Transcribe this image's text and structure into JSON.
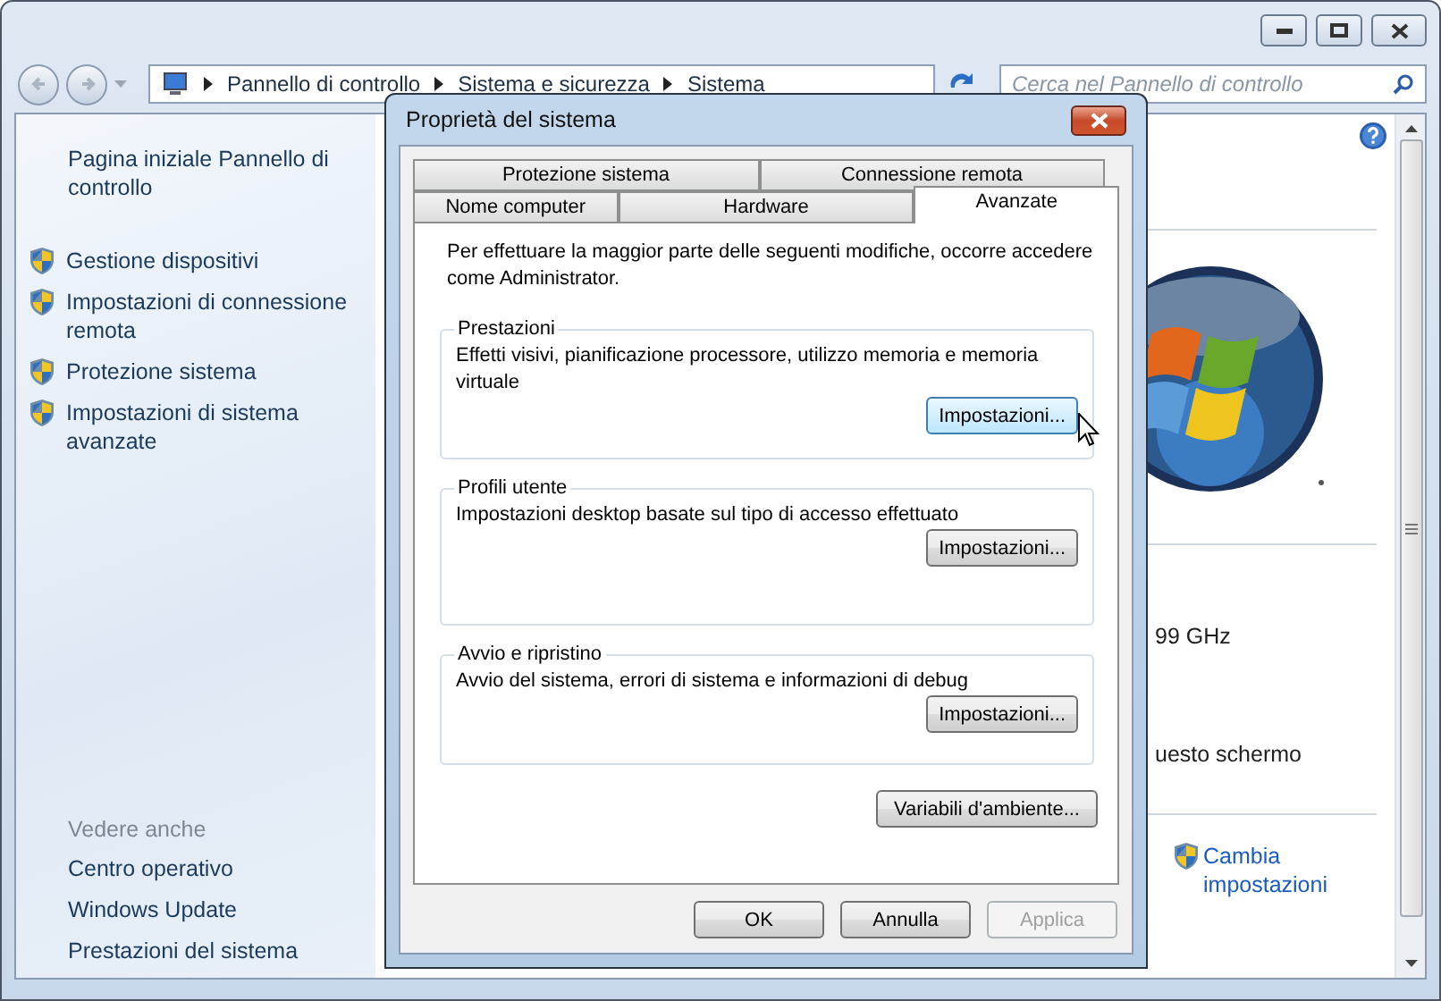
{
  "address_bar": {
    "breadcrumbs": [
      "Pannello di controllo",
      "Sistema e sicurezza",
      "Sistema"
    ]
  },
  "search": {
    "placeholder": "Cerca nel Pannello di controllo"
  },
  "sidebar": {
    "home_link": "Pagina iniziale Pannello di controllo",
    "tasks": [
      "Gestione dispositivi",
      "Impostazioni di connessione remota",
      "Protezione sistema",
      "Impostazioni di sistema avanzate"
    ],
    "see_also_title": "Vedere anche",
    "see_also": [
      "Centro operativo",
      "Windows Update",
      "Prestazioni del sistema"
    ]
  },
  "main": {
    "texts": [
      "99 GHz",
      "uesto schermo"
    ],
    "change_link": "Cambia impostazioni"
  },
  "dialog": {
    "title": "Proprietà del sistema",
    "tab_rows": [
      [
        {
          "label": "Protezione sistema",
          "selected": false
        },
        {
          "label": "Connessione remota",
          "selected": false
        }
      ],
      [
        {
          "label": "Nome computer",
          "selected": false
        },
        {
          "label": "Hardware",
          "selected": false
        },
        {
          "label": "Avanzate",
          "selected": true
        }
      ]
    ],
    "intro": "Per effettuare la maggior parte delle seguenti modifiche, occorre accedere come Administrator.",
    "groups": [
      {
        "title": "Prestazioni",
        "description": "Effetti visivi, pianificazione processore, utilizzo memoria e memoria virtuale",
        "button": "Impostazioni...",
        "hovered": true
      },
      {
        "title": "Profili utente",
        "description": "Impostazioni desktop basate sul tipo di accesso effettuato",
        "button": "Impostazioni...",
        "hovered": false
      },
      {
        "title": "Avvio e ripristino",
        "description": "Avvio del sistema, errori di sistema e informazioni di debug",
        "button": "Impostazioni...",
        "hovered": false
      }
    ],
    "env_button": "Variabili d'ambiente...",
    "buttons": [
      {
        "label": "OK",
        "disabled": false
      },
      {
        "label": "Annulla",
        "disabled": false
      },
      {
        "label": "Applica",
        "disabled": true
      }
    ]
  }
}
